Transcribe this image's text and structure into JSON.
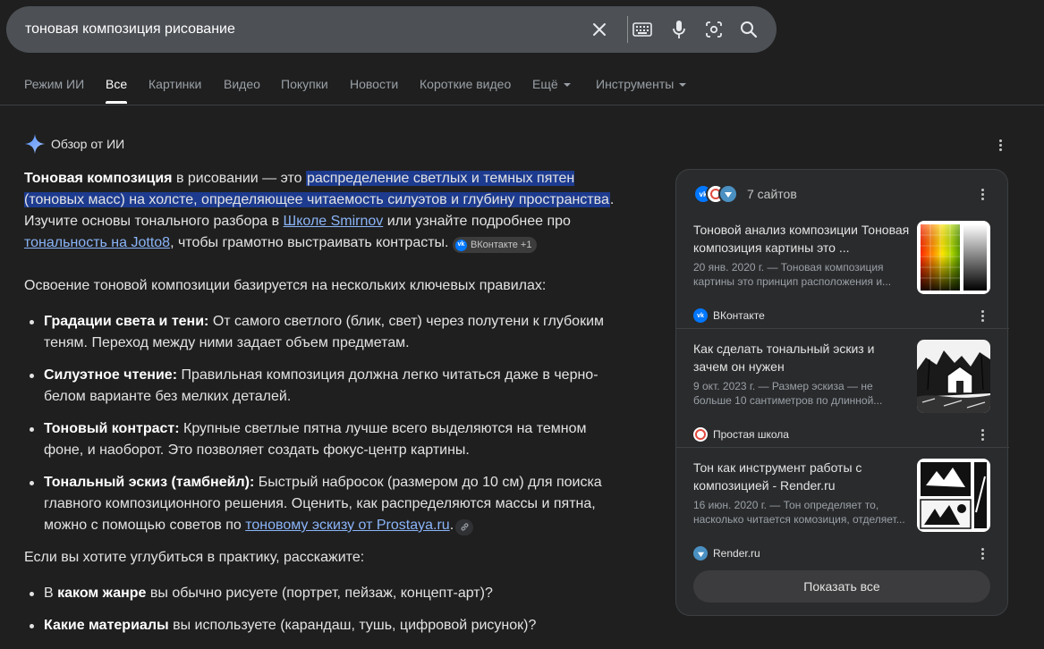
{
  "search": {
    "query": "тоновая композиция рисование"
  },
  "tabs": [
    {
      "label": "Режим ИИ"
    },
    {
      "label": "Все"
    },
    {
      "label": "Картинки"
    },
    {
      "label": "Видео"
    },
    {
      "label": "Покупки"
    },
    {
      "label": "Новости"
    },
    {
      "label": "Короткие видео"
    },
    {
      "label": "Ещё"
    },
    {
      "label": "Инструменты"
    }
  ],
  "active_tab": "Все",
  "ai_overview": {
    "title": "Обзор от ИИ",
    "p1": {
      "lead_bold": "Тоновая композиция",
      "t1": " в рисовании — это ",
      "highlight": "распределение светлых и темных пятен (тоновых масс) на холсте, определяющее читаемость силуэтов и глубину пространства",
      "t2": ". Изучите основы тонального разбора в ",
      "link1": "Школе Smirnov",
      "t3": " или узнайте подробнее про ",
      "link2": "тональность на Jotto8",
      "t4": ", чтобы грамотно выстраивать контрасты.",
      "chip_label": "ВКонтакте +1"
    },
    "intro": "Освоение тоновой композиции базируется на нескольких ключевых правилах:",
    "rules": [
      {
        "bold": "Градации света и тени:",
        "text": " От самого светлого (блик, свет) через полутени к глубоким теням. Переход между ними задает объем предметам."
      },
      {
        "bold": "Силуэтное чтение:",
        "text": " Правильная композиция должна легко читаться даже в черно-белом варианте без мелких деталей."
      },
      {
        "bold": "Тоновый контраст:",
        "text": " Крупные светлые пятна лучше всего выделяются на темном фоне, и наоборот. Это позволяет создать фокус-центр картины."
      },
      {
        "bold": "Тональный эскиз (тамбнейл):",
        "text": " Быстрый набросок (размером до 10 см) для поиска главного композиционного решения. Оценить, как распределяются массы и пятна, можно с помощью советов по ",
        "link": "тоновому эскизу от Prostaya.ru",
        "tail": "."
      }
    ],
    "ask": "Если вы хотите углубиться в практику, расскажите:",
    "questions": [
      {
        "pre": "В ",
        "bold": "каком жанре",
        "text": " вы обычно рисуете (портрет, пейзаж, концепт-арт)?"
      },
      {
        "pre": "",
        "bold": "Какие материалы",
        "text": " вы используете (карандаш, тушь, цифровой рисунок)?"
      }
    ]
  },
  "sources_panel": {
    "count_label": "7 сайтов",
    "items": [
      {
        "title": "Тоновой анализ композиции Тоновая композиция картины это ...",
        "snippet": "20 янв. 2020 г. — Тоновая композиция картины это принцип расположения и...",
        "site": "ВКонтакте"
      },
      {
        "title": "Как сделать тональный эскиз и зачем он нужен",
        "snippet": "9 окт. 2023 г. — Размер эскиза — не больше 10 сантиметров по длинной...",
        "site": "Простая школа"
      },
      {
        "title": "Тон как инструмент работы с композицией - Render.ru",
        "snippet": "16 июн. 2020 г. — Тон определяет то, насколько читается комозиция, отделяет...",
        "site": "Render.ru"
      }
    ],
    "show_all_label": "Показать все"
  },
  "colors": {
    "background": "#1f1f1f",
    "searchbar": "#4d5156",
    "highlight": "#1d3b8f",
    "link": "#8ab4f8",
    "panel": "#2a2b2d",
    "vk": "#0077ff"
  }
}
